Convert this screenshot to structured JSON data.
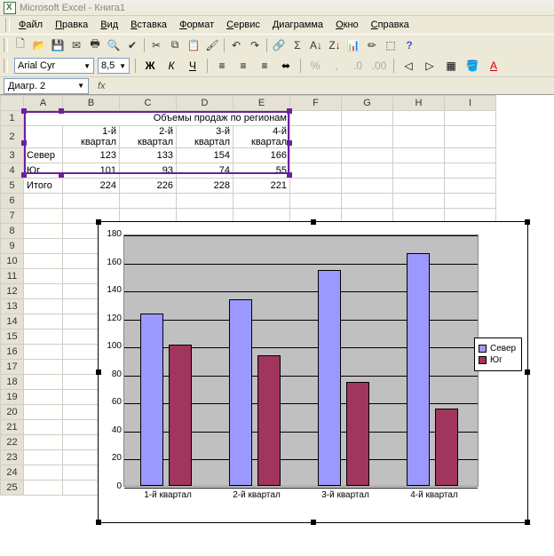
{
  "app": {
    "title": "Microsoft Excel - Книга1"
  },
  "menu": [
    "Файл",
    "Правка",
    "Вид",
    "Вставка",
    "Формат",
    "Сервис",
    "Диаграмма",
    "Окно",
    "Справка"
  ],
  "font": {
    "name": "Arial Cyr",
    "size": "8,5"
  },
  "namebox": "Диагр. 2",
  "columns": [
    "A",
    "B",
    "C",
    "D",
    "E",
    "F",
    "G",
    "H",
    "I"
  ],
  "row_count": 25,
  "cells": {
    "title": "Объемы продаж по регионам",
    "headers": [
      "",
      "1-й квартал",
      "2-й квартал",
      "3-й квартал",
      "4-й квартал"
    ],
    "rows": [
      {
        "label": "Север",
        "vals": [
          123,
          133,
          154,
          166
        ]
      },
      {
        "label": "Юг",
        "vals": [
          101,
          93,
          74,
          55
        ]
      },
      {
        "label": "Итого",
        "vals": [
          224,
          226,
          228,
          221
        ]
      }
    ]
  },
  "chart_data": {
    "type": "bar",
    "categories": [
      "1-й квартал",
      "2-й квартал",
      "3-й квартал",
      "4-й квартал"
    ],
    "series": [
      {
        "name": "Север",
        "values": [
          123,
          133,
          154,
          166
        ],
        "color": "#9b99ff"
      },
      {
        "name": "Юг",
        "values": [
          101,
          93,
          74,
          55
        ],
        "color": "#a0355e"
      }
    ],
    "ylim": [
      0,
      180
    ],
    "ystep": 20,
    "xlabel": "",
    "ylabel": ""
  }
}
